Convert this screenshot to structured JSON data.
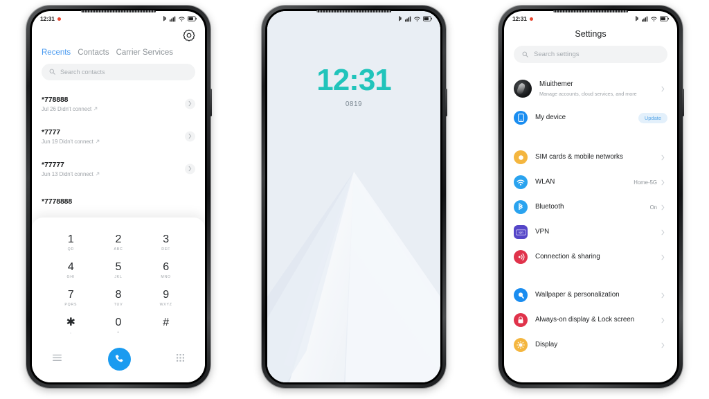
{
  "background_color": "#ffffff",
  "accent_colors": {
    "dialer_blue": "#1a9bf0",
    "tab_active": "#4a9bf0",
    "clock_teal": "#21c4bb",
    "badge_bg": "#e3f0fb",
    "badge_text": "#58a7e8"
  },
  "phone1": {
    "status_bar": {
      "time": "12:31",
      "icons": [
        "bluetooth-icon",
        "signal-icon",
        "wifi-icon",
        "battery-icon"
      ]
    },
    "gear_icon": "settings-gear-icon",
    "tabs": [
      {
        "label": "Recents",
        "active": true
      },
      {
        "label": "Contacts",
        "active": false
      },
      {
        "label": "Carrier Services",
        "active": false
      }
    ],
    "search": {
      "placeholder": "Search contacts",
      "icon": "search-icon"
    },
    "calls": [
      {
        "number": "*778888",
        "detail": "Jul 26 Didn't connect"
      },
      {
        "number": "*7777",
        "detail": "Jun 19 Didn't connect"
      },
      {
        "number": "*77777",
        "detail": "Jun 13 Didn't connect"
      },
      {
        "number": "*7778888",
        "detail": ""
      }
    ],
    "keypad": [
      {
        "digit": "1",
        "letters": "QD"
      },
      {
        "digit": "2",
        "letters": "ABC"
      },
      {
        "digit": "3",
        "letters": "DEF"
      },
      {
        "digit": "4",
        "letters": "GHI"
      },
      {
        "digit": "5",
        "letters": "JKL"
      },
      {
        "digit": "6",
        "letters": "MNO"
      },
      {
        "digit": "7",
        "letters": "PQRS"
      },
      {
        "digit": "8",
        "letters": "TUV"
      },
      {
        "digit": "9",
        "letters": "WXYZ"
      },
      {
        "digit": "✱",
        "letters": ","
      },
      {
        "digit": "0",
        "letters": "+"
      },
      {
        "digit": "#",
        "letters": ""
      }
    ],
    "actions": {
      "left_icon": "menu-lines-icon",
      "call_icon": "phone-call-icon",
      "right_icon": "keypad-grid-icon"
    }
  },
  "phone2": {
    "status_bar": {
      "time": "",
      "icons": [
        "bluetooth-icon",
        "signal-icon",
        "wifi-icon",
        "battery-icon"
      ]
    },
    "lock": {
      "time": "12:31",
      "date": "0819"
    },
    "wallpaper": "geometric-mountain-light"
  },
  "phone3": {
    "status_bar": {
      "time": "12:31",
      "icons": [
        "bluetooth-icon",
        "signal-icon",
        "wifi-icon",
        "battery-icon"
      ]
    },
    "title": "Settings",
    "search": {
      "placeholder": "Search settings",
      "icon": "search-icon"
    },
    "account": {
      "name": "Miuithemer",
      "subtitle": "Manage accounts, cloud services, and more"
    },
    "device": {
      "label": "My device",
      "badge": "Update",
      "icon_color": "#1a8df0"
    },
    "group_network": [
      {
        "label": "SIM cards & mobile networks",
        "value": "",
        "icon": "sim-card-icon",
        "color": "#f4b63f",
        "shape": "ring"
      },
      {
        "label": "WLAN",
        "value": "Home-5G",
        "icon": "wifi-icon",
        "color": "#2aa3ef",
        "shape": "circle"
      },
      {
        "label": "Bluetooth",
        "value": "On",
        "icon": "bluetooth-icon",
        "color": "#2aa3ef",
        "shape": "circle"
      },
      {
        "label": "VPN",
        "value": "",
        "icon": "vpn-icon",
        "color": "#5546c8",
        "shape": "square"
      },
      {
        "label": "Connection & sharing",
        "value": "",
        "icon": "connection-sharing-icon",
        "color": "#e0334b",
        "shape": "circle"
      }
    ],
    "group_display": [
      {
        "label": "Wallpaper & personalization",
        "value": "",
        "icon": "wallpaper-icon",
        "color": "#1a8df0",
        "shape": "circle"
      },
      {
        "label": "Always-on display & Lock screen",
        "value": "",
        "icon": "lock-icon",
        "color": "#e0334b",
        "shape": "circle"
      },
      {
        "label": "Display",
        "value": "",
        "icon": "display-sun-icon",
        "color": "#f4b63f",
        "shape": "circle"
      }
    ]
  }
}
